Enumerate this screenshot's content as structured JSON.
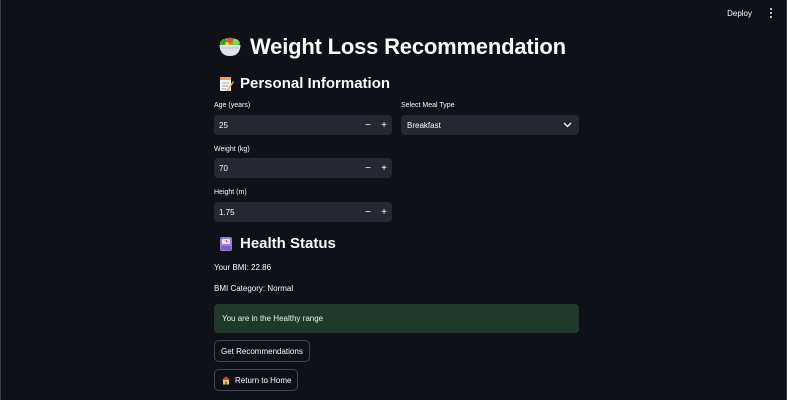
{
  "header": {
    "deploy_label": "Deploy"
  },
  "page": {
    "title": "Weight Loss Recommendation"
  },
  "personal_info": {
    "heading": "Personal Information",
    "age": {
      "label": "Age (years)",
      "value": "25"
    },
    "weight": {
      "label": "Weight (kg)",
      "value": "70"
    },
    "height": {
      "label": "Height (m)",
      "value": "1.75"
    },
    "meal": {
      "label": "Select Meal Type",
      "selected": "Breakfast"
    },
    "minus_symbol": "−",
    "plus_symbol": "+"
  },
  "health_status": {
    "heading": "Health Status",
    "bmi_text": "Your BMI: 22.86",
    "category_text": "BMI Category: Normal",
    "alert_text": "You are in the Healthy range"
  },
  "actions": {
    "recommend_label": "Get Recommendations",
    "home_label": "Return to Home"
  },
  "icons": {
    "title": "salad-bowl-icon",
    "personal": "memo-icon",
    "health": "scale-icon",
    "home": "house-icon"
  },
  "colors": {
    "background": "#0e1117",
    "input_bg": "#262730",
    "success_bg": "#1f3a2c"
  }
}
